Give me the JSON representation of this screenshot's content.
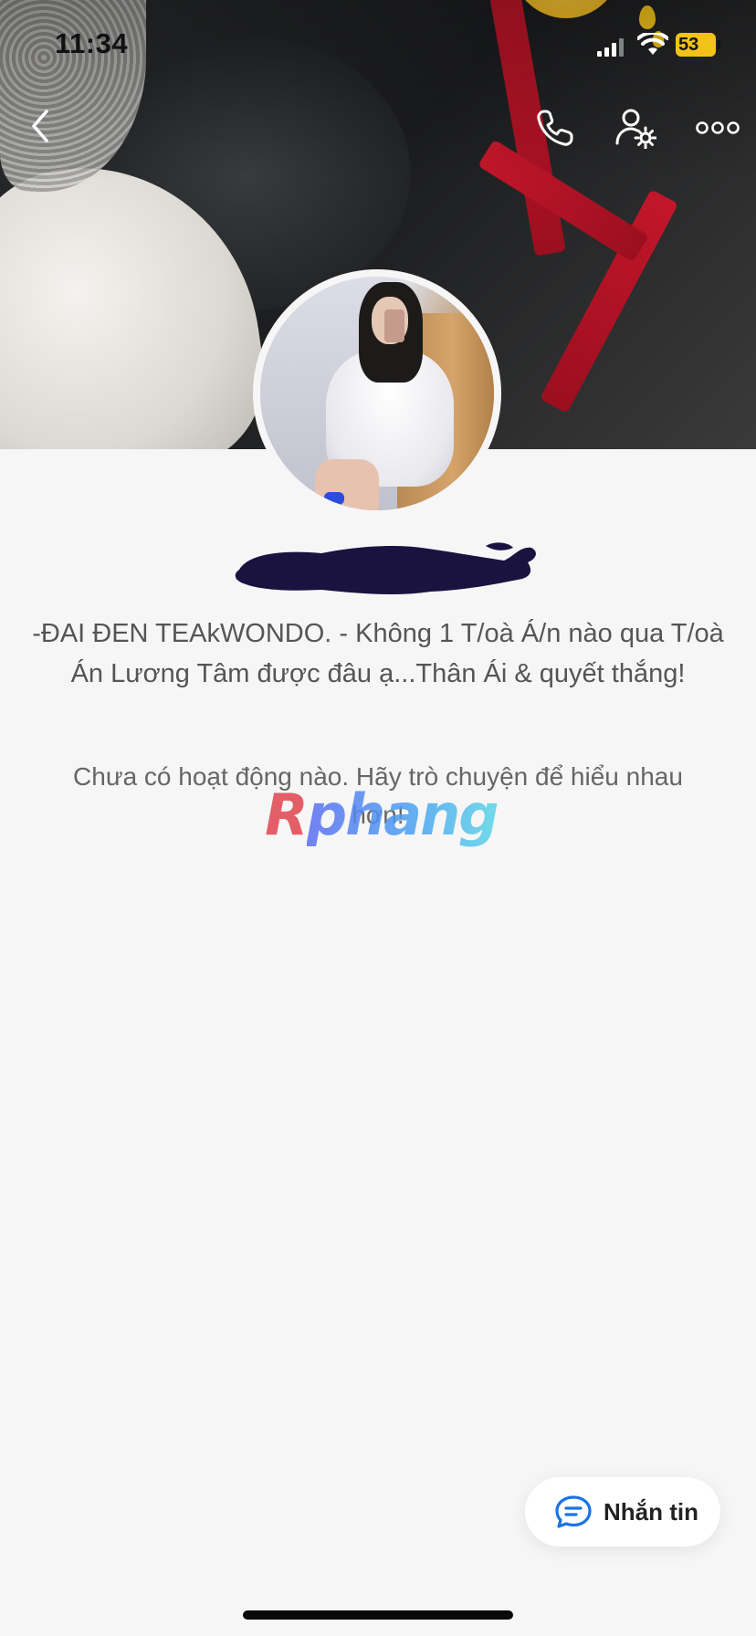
{
  "status_bar": {
    "time": "11:34",
    "battery": "53"
  },
  "header": {
    "back_icon": "chevron-left-icon",
    "call_icon": "phone-icon",
    "manage_icon": "user-gear-icon",
    "more_icon": "ellipsis-icon"
  },
  "profile": {
    "name": "",
    "bio": "-ĐAI ĐEN TEAkWONDO. - Không 1 T/oà Á/n nào qua T/oà Án Lương Tâm được đâu ạ...Thân Ái & quyết thắng!"
  },
  "activity": {
    "empty_message": "Chưa có hoạt động nào. Hãy trò chuyện để hiểu nhau hơn!"
  },
  "watermark": {
    "first": "R",
    "rest": "phang"
  },
  "actions": {
    "message_label": "Nhắn tin",
    "message_icon": "chat-bubble-icon"
  },
  "colors": {
    "background": "#f6f6f7",
    "message_icon": "#1a73e8",
    "battery": "#f3c21a",
    "strap": "#c3162a"
  }
}
